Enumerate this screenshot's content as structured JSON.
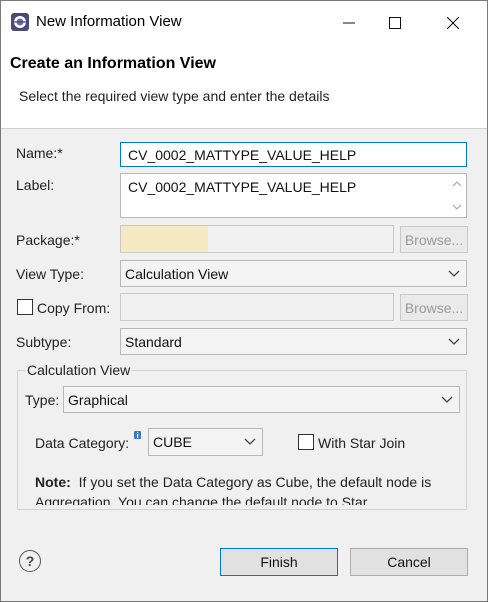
{
  "window": {
    "title": "New Information View"
  },
  "header": {
    "title": "Create an Information View",
    "description": "Select the required view type and enter the details"
  },
  "form": {
    "name_label": "Name:*",
    "name_value": "CV_0002_MATTYPE_VALUE_HELP",
    "label_label": "Label:",
    "label_value": "CV_0002_MATTYPE_VALUE_HELP",
    "package_label": "Package:*",
    "package_value": "",
    "browse_label": "Browse...",
    "view_type_label": "View Type:",
    "view_type_value": "Calculation View",
    "copy_from_label": "Copy From:",
    "copy_from_checked": false,
    "copy_from_value": "",
    "subtype_label": "Subtype:",
    "subtype_value": "Standard"
  },
  "calc_view_group": {
    "title": "Calculation View",
    "type_label": "Type:",
    "type_value": "Graphical",
    "data_category_label": "Data Category:",
    "data_category_value": "CUBE",
    "star_join_label": "With Star Join",
    "star_join_checked": false,
    "note_label": "Note:",
    "note_text": "If you set the Data Category as Cube, the default node is Aggregation. You can change the default node to Star"
  },
  "footer": {
    "help_icon_glyph": "?",
    "finish_label": "Finish",
    "cancel_label": "Cancel"
  },
  "colors": {
    "package_highlight": "#f5e9c4",
    "accent_border": "#0078d7",
    "info_icon": "#3c78c8"
  }
}
